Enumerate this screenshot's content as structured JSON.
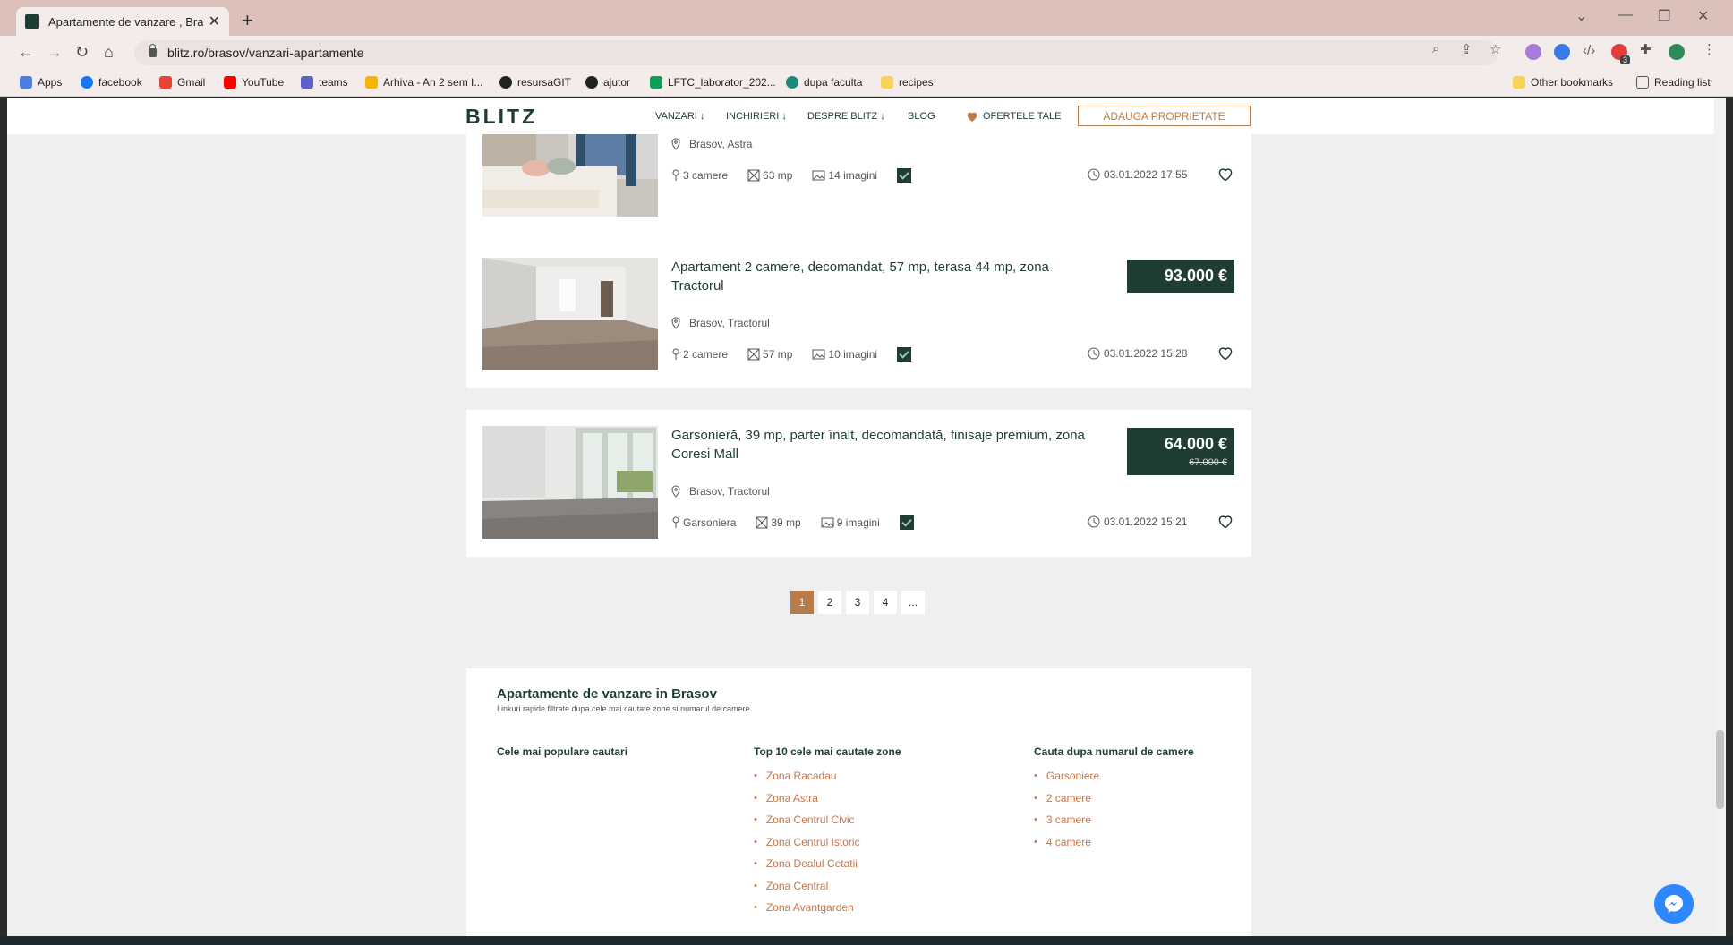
{
  "browser": {
    "tab_title": "Apartamente de vanzare , Brasov",
    "url": "blitz.ro/brasov/vanzari-apartamente",
    "bookmarks": [
      "Apps",
      "facebook",
      "Gmail",
      "YouTube",
      "teams",
      "Arhiva - An 2 sem I...",
      "resursaGIT",
      "ajutor",
      "LFTC_laborator_202...",
      "dupa faculta",
      "recipes"
    ],
    "other_bookmarks": "Other bookmarks",
    "reading_list": "Reading list",
    "extension_badge": "3"
  },
  "header": {
    "logo": "BLITZ",
    "nav": [
      "VANZARI",
      "INCHIRIERI",
      "DESPRE BLITZ",
      "BLOG"
    ],
    "favorites": "OFERTELE TALE",
    "add_property": "ADAUGA PROPRIETATE"
  },
  "listings": [
    {
      "location": "Brasov, Astra",
      "rooms": "3 camere",
      "area": "63 mp",
      "images": "14 imagini",
      "date": "03.01.2022 17:55"
    },
    {
      "title": "Apartament 2 camere, decomandat, 57 mp, terasa 44 mp, zona Tractorul",
      "location": "Brasov, Tractorul",
      "rooms": "2 camere",
      "area": "57 mp",
      "images": "10 imagini",
      "date": "03.01.2022 15:28",
      "price": "93.000 €"
    },
    {
      "title": "Garsonieră, 39 mp, parter înalt, decomandată, finisaje premium, zona Coresi Mall",
      "location": "Brasov, Tractorul",
      "rooms": "Garsoniera",
      "area": "39 mp",
      "images": "9 imagini",
      "date": "03.01.2022 15:21",
      "price": "64.000 €",
      "old_price": "67.000 €"
    }
  ],
  "pagination": [
    "1",
    "2",
    "3",
    "4",
    "..."
  ],
  "seo": {
    "title": "Apartamente de vanzare in Brasov",
    "subtitle": "Linkuri rapide filtrate dupa cele mai cautate zone si numarul de camere",
    "col1_title": "Cele mai populare cautari",
    "col2_title": "Top 10 cele mai cautate zone",
    "col3_title": "Cauta dupa numarul de camere",
    "zones": [
      "Zona Racadau",
      "Zona Astra",
      "Zona Centrul Civic",
      "Zona Centrul Istoric",
      "Zona Dealul Cetatii",
      "Zona Central",
      "Zona Avantgarden"
    ],
    "room_links": [
      "Garsoniere",
      "2 camere",
      "3 camere",
      "4 camere"
    ]
  }
}
